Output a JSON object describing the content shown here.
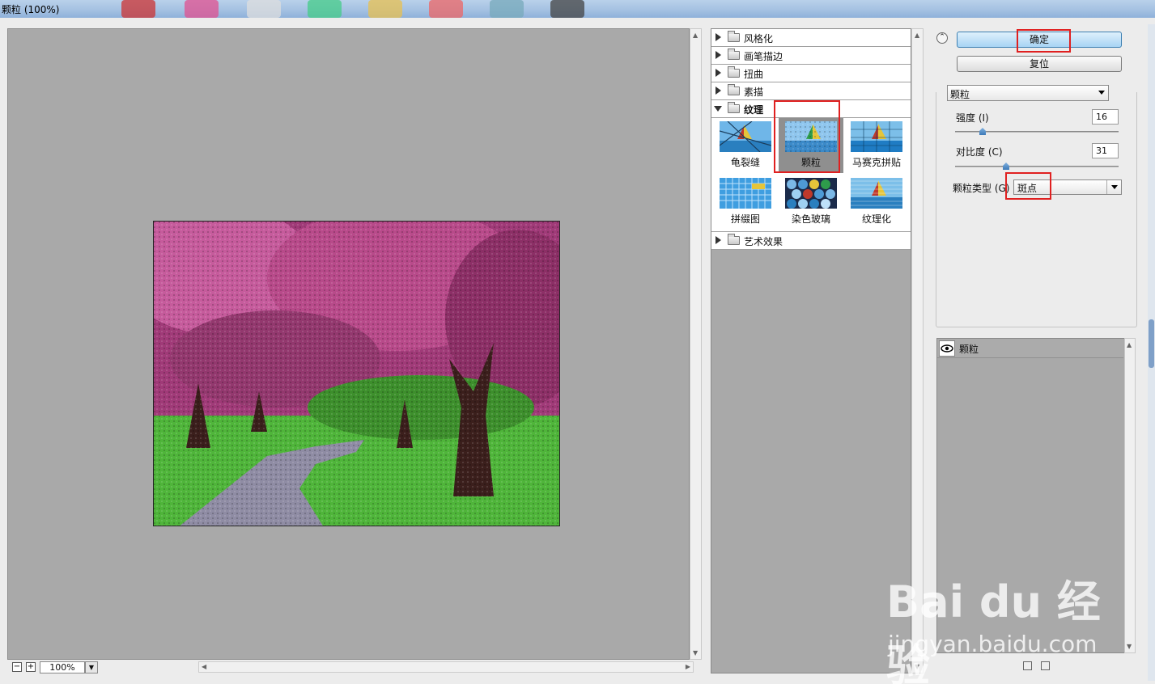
{
  "window": {
    "title": "颗粒 (100%)"
  },
  "preview": {
    "zoom": "100%",
    "zoom_out": "−",
    "zoom_in": "+"
  },
  "filter_tree": {
    "categories": [
      {
        "label": "风格化",
        "expanded": false
      },
      {
        "label": "画笔描边",
        "expanded": false
      },
      {
        "label": "扭曲",
        "expanded": false
      },
      {
        "label": "素描",
        "expanded": false
      },
      {
        "label": "纹理",
        "expanded": true
      },
      {
        "label": "艺术效果",
        "expanded": false
      }
    ],
    "texture_filters": [
      {
        "label": "龟裂缝",
        "selected": false
      },
      {
        "label": "颗粒",
        "selected": true
      },
      {
        "label": "马赛克拼贴",
        "selected": false
      },
      {
        "label": "拼缀图",
        "selected": false
      },
      {
        "label": "染色玻璃",
        "selected": false
      },
      {
        "label": "纹理化",
        "selected": false
      }
    ]
  },
  "buttons": {
    "ok": "确定",
    "reset": "复位"
  },
  "settings": {
    "filter": "颗粒",
    "intensity_label": "强度 (I)",
    "intensity": "16",
    "contrast_label": "对比度 (C)",
    "contrast": "31",
    "grain_type_label": "颗粒类型 (G)",
    "grain_type": "斑点"
  },
  "layers": {
    "effect_layer": "颗粒"
  },
  "watermark": {
    "logo": "Bai du 经验",
    "site": "jingyan.baidu.com"
  },
  "colors": {
    "selection_highlight": "#e02020",
    "ok_button": "#a7d4f4",
    "canvas_bg": "#a9a9a9"
  }
}
